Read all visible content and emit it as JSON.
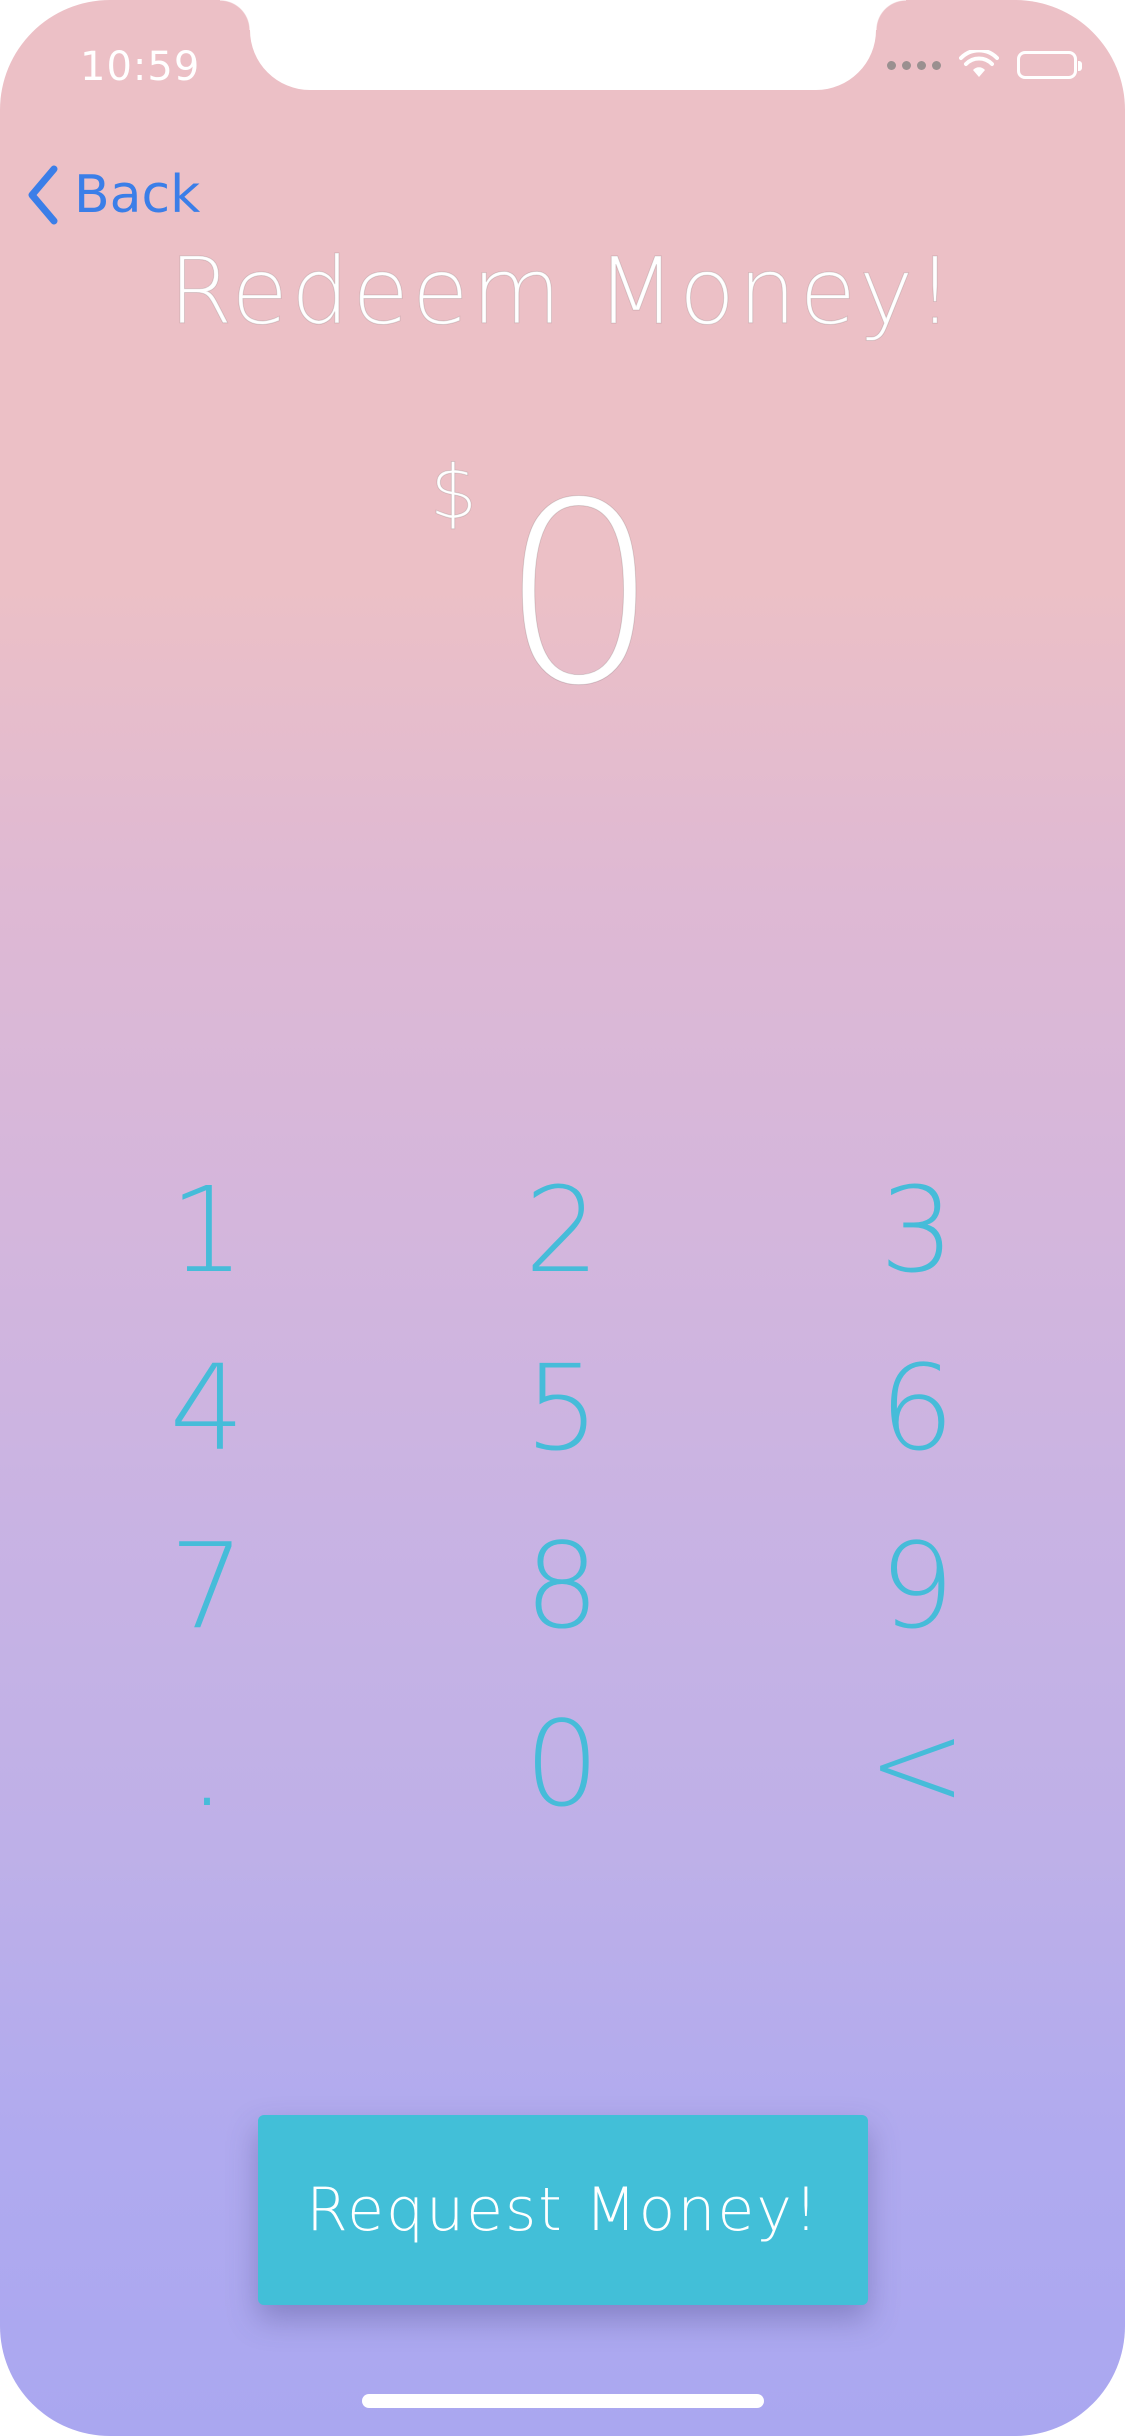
{
  "status_bar": {
    "time": "10:59",
    "wifi_icon": "wifi-icon",
    "battery_icon": "battery-icon"
  },
  "nav": {
    "back_label": "Back",
    "back_icon": "chevron-left-icon",
    "accent_color": "#3b7ee8"
  },
  "title": "Redeem Money!",
  "amount": {
    "currency_symbol": "$",
    "value": "0"
  },
  "keypad": {
    "key_color": "#46bcd9",
    "keys": [
      "1",
      "2",
      "3",
      "4",
      "5",
      "6",
      "7",
      "8",
      "9",
      ".",
      "0",
      "<"
    ]
  },
  "request_button": {
    "label": "Request Money!",
    "color": "#42bfd8"
  }
}
